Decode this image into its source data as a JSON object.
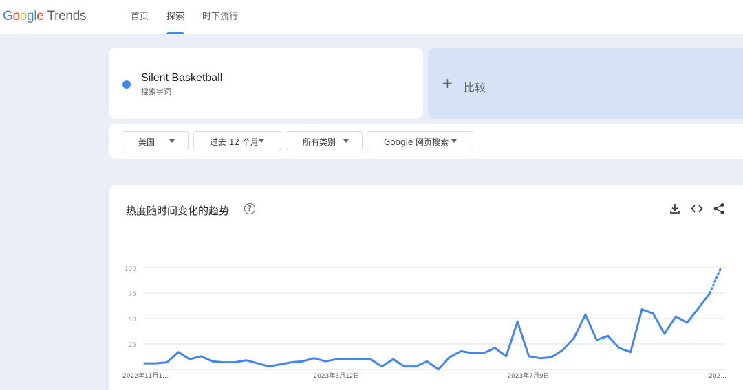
{
  "header": {
    "logo": {
      "google": "Google",
      "trends": "Trends"
    },
    "tabs": [
      {
        "label": "首页",
        "active": false
      },
      {
        "label": "探索",
        "active": true
      },
      {
        "label": "时下流行",
        "active": false
      }
    ]
  },
  "search_term": {
    "name": "Silent Basketball",
    "subtitle": "搜索字词",
    "color": "#4285f4"
  },
  "compare": {
    "plus": "+",
    "label": "比较"
  },
  "filters": {
    "region": "美国",
    "time": "过去 12 个月",
    "category": "所有类别",
    "property": "Google 网页搜索"
  },
  "chart_panel": {
    "title": "热度随时间变化的趋势",
    "help": "?",
    "icons": [
      "download-icon",
      "embed-icon",
      "share-icon"
    ]
  },
  "chart_data": {
    "type": "line",
    "ylim": [
      0,
      100
    ],
    "yticks": [
      "100",
      "75",
      "50",
      "25"
    ],
    "x_labels": [
      "2022年11月1...",
      "2023年3月12日",
      "2023年7月9日",
      "202..."
    ],
    "grid": true,
    "series": [
      {
        "color": "#4285f4",
        "values": [
          6,
          6,
          7,
          17,
          10,
          13,
          8,
          7,
          7,
          9,
          6,
          3,
          5,
          7,
          8,
          11,
          8,
          10,
          10,
          10,
          10,
          3,
          10,
          3,
          3,
          8,
          0,
          12,
          18,
          16,
          16,
          21,
          13,
          47,
          13,
          11,
          12,
          19,
          31,
          54,
          29,
          33,
          21,
          17,
          59,
          55,
          35,
          52,
          46,
          60,
          75
        ],
        "partial_values": [
          75,
          100
        ]
      }
    ]
  }
}
